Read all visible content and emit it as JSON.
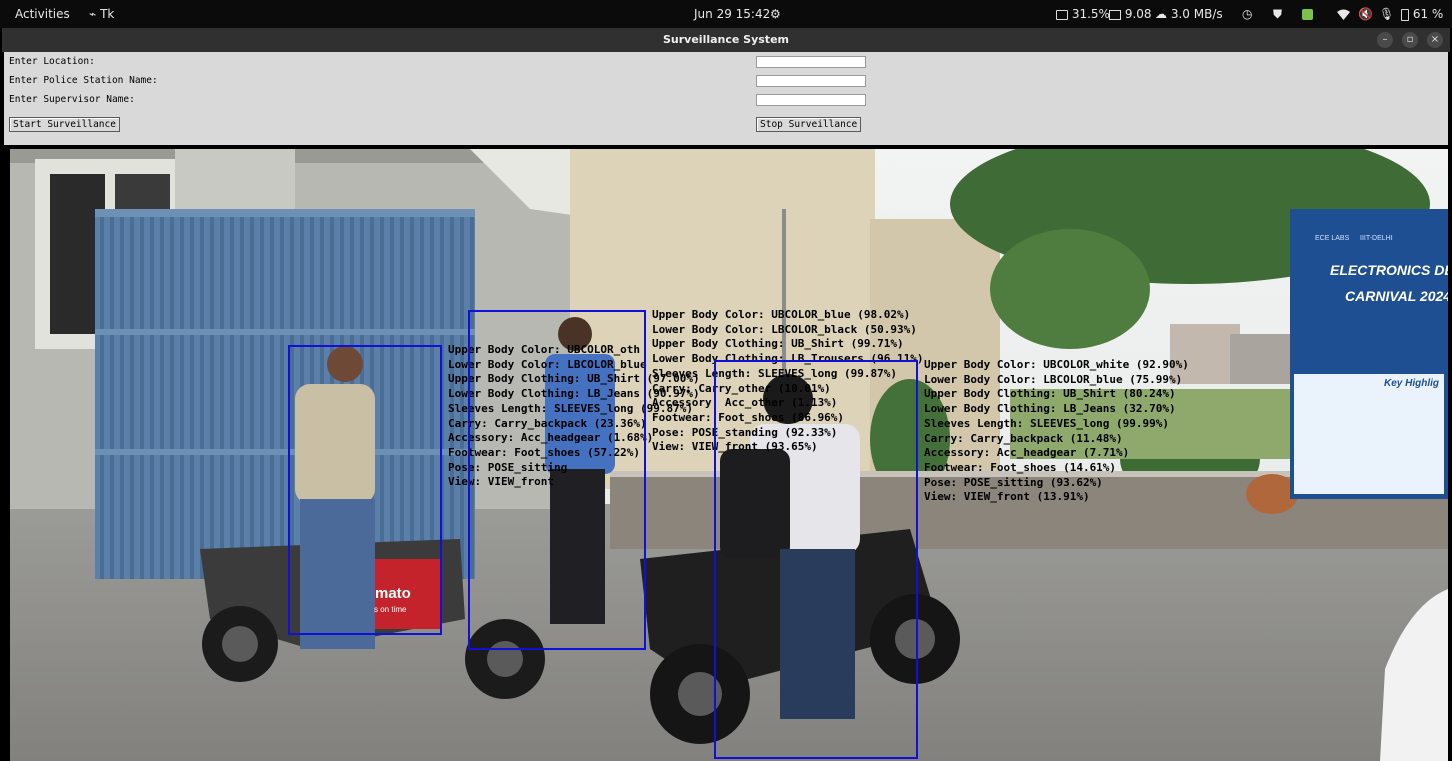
{
  "topbar": {
    "activities": "Activities",
    "app_name": "Tk",
    "clock": "Jun 29  15:42",
    "cpu": "31.5%",
    "mem": "9.08",
    "net": "3.0 MB/s",
    "battery": "61 %"
  },
  "window": {
    "title": "Surveillance System",
    "minimize": "–",
    "maximize": "▫",
    "close": "×"
  },
  "form": {
    "location_label": "Enter Location:",
    "location_value": "",
    "police_station_label": "Enter Police Station Name:",
    "police_station_value": "",
    "supervisor_label": "Enter Supervisor Name:",
    "supervisor_value": "",
    "start_button": "Start Surveillance",
    "stop_button": "Stop Surveillance"
  },
  "video": {
    "scene_sign_line1": "ELECTRONICS DES",
    "scene_sign_line2": "CARNIVAL 2024",
    "scene_sign_small1": "ECE LABS",
    "scene_sign_small2": "IIIT-DELHI",
    "scene_sign_highlights": "Key Highlig",
    "scooter_brand": "mato",
    "scooter_tag": "s on time",
    "detections": [
      {
        "attributes": [
          "Upper Body Color: UBCOLOR_oth",
          "Lower Body Color: LBCOLOR_blue",
          "Upper Body Clothing: UB_Shirt (97.00%)",
          "Lower Body Clothing: LB_Jeans (90.97%)",
          "Sleeves Length: SLEEVES_long (99.87%)",
          "Carry: Carry_backpack (23.36%)",
          "Accessory: Acc_headgear (1.68%)",
          "Footwear: Foot_shoes (57.22%)",
          "Pose: POSE_sitting",
          "View: VIEW_front"
        ]
      },
      {
        "attributes": [
          "Upper Body Color: UBCOLOR_blue (98.02%)",
          "Lower Body Color: LBCOLOR_black (50.93%)",
          "Upper Body Clothing: UB_Shirt (99.71%)",
          "Lower Body Clothing: LB_Trousers (96.11%)",
          "Sleeves Length: SLEEVES_long (99.87%)",
          "Carry: Carry_other (10.01%)",
          "Accessory: Acc_other (1.13%)",
          "Footwear: Foot_shoes (86.96%)",
          "Pose: POSE_standing (92.33%)",
          "View: VIEW_front (93.65%)"
        ]
      },
      {
        "attributes": [
          "Upper Body Color: UBCOLOR_white (92.90%)",
          "Lower Body Color: LBCOLOR_blue (75.99%)",
          "Upper Body Clothing: UB_Shirt (80.24%)",
          "Lower Body Clothing: LB_Jeans (32.70%)",
          "Sleeves Length: SLEEVES_long (99.99%)",
          "Carry: Carry_backpack (11.48%)",
          "Accessory: Acc_headgear (7.71%)",
          "Footwear: Foot_shoes (14.61%)",
          "Pose: POSE_sitting (93.62%)",
          "View: VIEW_front (13.91%)"
        ]
      }
    ]
  }
}
